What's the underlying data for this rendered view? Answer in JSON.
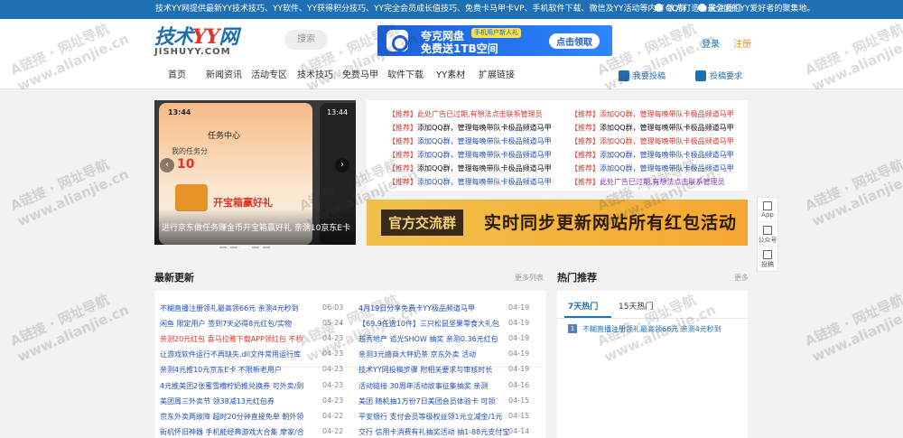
{
  "topbar": {
    "notice": "技术YY网提供最新YY技术技巧、YY软件、YY获得积分技巧、YY完全会员成长值技巧、免费卡马甲卡VP、手机软件下载、微信及YY活动等内容 致力打造为最全面的YY爱好者的聚集地。",
    "qq": "QQ群",
    "follow": "关注我们"
  },
  "header": {
    "logo_main_a": "技术",
    "logo_main_b": "YY",
    "logo_main_c": "网",
    "logo_sub": "JISHUYY.COM",
    "search_placeholder": "搜索",
    "banner": {
      "line1": "夸克网盘",
      "line2": "免费送1TB空间",
      "tag": "手机用户新人礼",
      "cta": "点击领取"
    },
    "login": "登录",
    "register": "注册"
  },
  "nav": {
    "items": [
      "首页",
      "新闻资讯",
      "活动专区",
      "技术技巧",
      "免费马甲",
      "软件下载",
      "YY素材",
      "扩展链接"
    ],
    "contribute": "我要投稿",
    "request": "投稿要求"
  },
  "slider": {
    "time_left": "13:44",
    "time_right": "13:44",
    "task_center": "任务中心",
    "my_value": "我的任务分",
    "value": "10",
    "treasure": "开宝箱赢好礼",
    "caption": "进行京东做任务赚金币开宝箱赢好礼 亲测10京东E卡",
    "prev": "‹",
    "next": "›",
    "slide_count": 5,
    "active_slide": 2
  },
  "ads": {
    "tag": "【推荐】",
    "left": [
      "此处广告已过期,有想法点击联系管理员",
      "添加QQ群，管理每晚带队卡极品频道马甲",
      "添加QQ群，管理每晚带队卡极品频道马甲",
      "添加QQ群，管理每晚带队卡极品频道马甲",
      "添加QQ群，管理每晚带队卡极品频道马甲",
      "添加QQ群，管理每晚带队卡极品频道马甲"
    ],
    "right": [
      "添加QQ群，管理每晚带队卡极品频道马甲",
      "添加QQ群，管理每晚带队卡极品频道马甲",
      "添加QQ群，管理每晚带队卡极品频道马甲",
      "添加QQ群，管理每晚带队卡极品频道马甲",
      "添加QQ群，管理每晚带队卡极品频道马甲",
      "此处广告已过期,有想法点击联系管理员"
    ],
    "left_colors": [
      "#e0342b",
      "#111111",
      "#1f4fb5",
      "#1f4fb5",
      "#111111",
      "#1f4fb5"
    ],
    "right_colors": [
      "#e0342b",
      "#111111",
      "#e0342b",
      "#1f4fb5",
      "#1f4fb5",
      "#8a2bd6"
    ]
  },
  "adbanner": {
    "left": "官方交流群",
    "right": "实时同步更新网站所有红包活动"
  },
  "float": [
    "App",
    "公众号",
    "投稿"
  ],
  "latest": {
    "title": "最新更新",
    "more": "更多列表",
    "left": [
      {
        "t": "不糊直播注册领礼最高领66元 亲测4元秒到",
        "d": "06-03",
        "red": false
      },
      {
        "t": "闲鱼 限定用户 签到7天必得8元红包/实物",
        "d": "05-24",
        "red": false
      },
      {
        "t": "亲测20元红包 喜马拉雅下载APP领红包 不秒",
        "d": "04-23",
        "red": true
      },
      {
        "t": "让游戏软件运行不再缺失.dll文件常用运行库",
        "d": "04-23",
        "red": false
      },
      {
        "t": "亲测4元推10元京东E卡 不限新老用户",
        "d": "04-23",
        "red": false
      },
      {
        "t": "4元推美团2张蜜雪槽柠奶推兑换券 可外卖/到",
        "d": "04-23",
        "red": false
      },
      {
        "t": "美团周三外卖节 领38减13元红包券",
        "d": "04-23",
        "red": false
      },
      {
        "t": "京东外卖两故障 超时20分钟直接免单 朝外领",
        "d": "04-22",
        "red": false
      },
      {
        "t": "街机怀旧神器 手机能经典游戏大合集 摩家/合",
        "d": "04-22",
        "red": false
      }
    ],
    "right": [
      {
        "t": "4月19日分享免费卡YY极品频道马甲",
        "d": "04-19"
      },
      {
        "t": "【69.9任选10件】三只松鼠坚果零食大礼包",
        "d": "04-19"
      },
      {
        "t": "越秀地产 追光SHOW 抽奖 亲测0.36元红包",
        "d": "04-19"
      },
      {
        "t": "亲测3元撸商大秤奶茶 京东外卖 活动",
        "d": "04-19"
      },
      {
        "t": "技术YY网投稿步骤 附相关要求与审核时长",
        "d": "04-19"
      },
      {
        "t": "活动链接 30周年活动故事征集抽奖 亲测",
        "d": "04-16"
      },
      {
        "t": "美团 随机抽1万份7日美团会员体验卡 可领",
        "d": "04-15"
      },
      {
        "t": "平安银行 支付会员等级权益领1元立减金/1元",
        "d": "04-15"
      },
      {
        "t": "交行 信用卡消费有礼抽奖活动 抽1-88元支付宝",
        "d": "04-14"
      }
    ]
  },
  "hot": {
    "title": "热门推荐",
    "more": "更多",
    "tabs": [
      "7天热门",
      "15天热门"
    ],
    "items": [
      {
        "n": "1",
        "t": "不糊直播注册领礼最高领66元 亲测4元秒到"
      }
    ]
  },
  "watermark": [
    "A链接 · 网址导航",
    "www.alianjie.cn"
  ]
}
